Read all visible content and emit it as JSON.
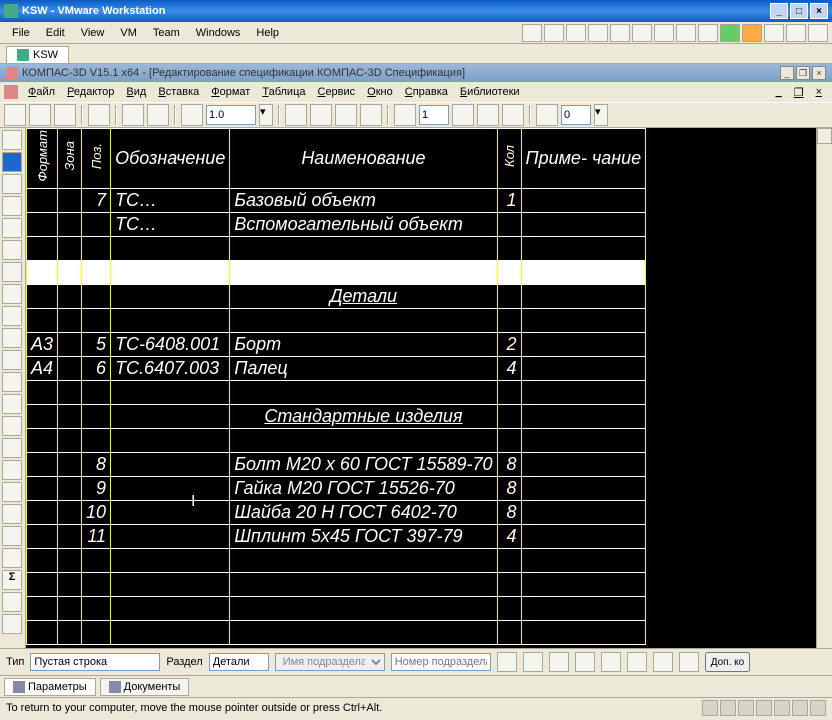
{
  "vmware": {
    "title": "KSW - VMware Workstation",
    "menu": [
      "File",
      "Edit",
      "View",
      "VM",
      "Team",
      "Windows",
      "Help"
    ],
    "tab": "KSW",
    "status": "To return to your computer, move the mouse pointer outside or press Ctrl+Alt."
  },
  "kompas": {
    "title": "КОМПАС-3D V15.1 x64 - [Редактирование спецификации КОМПАС-3D Спецификация]",
    "menu": [
      "Файл",
      "Редактор",
      "Вид",
      "Вставка",
      "Формат",
      "Таблица",
      "Сервис",
      "Окно",
      "Справка",
      "Библиотеки"
    ],
    "zoom": "1.0",
    "page": "1",
    "offset": "0"
  },
  "spec": {
    "headers": {
      "format": "Формат",
      "zona": "Зона",
      "poz": "Поз.",
      "oboz": "Обозначение",
      "naim": "Наименование",
      "kol": "Кол",
      "prim": "Приме-\nчание"
    },
    "rows": [
      {
        "fmt": "",
        "zona": "",
        "poz": "7",
        "oboz": "ТС…",
        "naim": "Базовый объект",
        "kol": "1",
        "prim": ""
      },
      {
        "fmt": "",
        "zona": "",
        "poz": "",
        "oboz": "ТС…",
        "naim": "Вспомогательный объект",
        "kol": "",
        "prim": ""
      },
      {
        "type": "empty"
      },
      {
        "type": "selected"
      },
      {
        "type": "section",
        "naim": "Детали"
      },
      {
        "type": "empty"
      },
      {
        "fmt": "А3",
        "zona": "",
        "poz": "5",
        "oboz": "ТС-6408.001",
        "naim": "Борт",
        "kol": "2",
        "prim": ""
      },
      {
        "fmt": "А4",
        "zona": "",
        "poz": "6",
        "oboz": "ТС.6407.003",
        "naim": "Палец",
        "kol": "4",
        "prim": ""
      },
      {
        "type": "empty"
      },
      {
        "type": "section",
        "naim": "Стандартные изделия"
      },
      {
        "type": "empty"
      },
      {
        "fmt": "",
        "zona": "",
        "poz": "8",
        "oboz": "",
        "naim": "Болт М20 х 60 ГОСТ 15589-70",
        "kol": "8",
        "prim": ""
      },
      {
        "fmt": "",
        "zona": "",
        "poz": "9",
        "oboz": "",
        "naim": "Гайка М20 ГОСТ 15526-70",
        "kol": "8",
        "prim": ""
      },
      {
        "fmt": "",
        "zona": "",
        "poz": "10",
        "oboz": "",
        "naim": "Шайба 20 Н ГОСТ 6402-70",
        "kol": "8",
        "prim": ""
      },
      {
        "fmt": "",
        "zona": "",
        "poz": "11",
        "oboz": "",
        "naim": "Шплинт 5х45 ГОСТ 397-79",
        "kol": "4",
        "prim": ""
      },
      {
        "type": "empty"
      },
      {
        "type": "empty"
      },
      {
        "type": "empty"
      },
      {
        "type": "empty"
      }
    ]
  },
  "bottom": {
    "tip_label": "Тип",
    "tip_value": "Пустая строка",
    "razdel_label": "Раздел",
    "razdel_value": "Детали",
    "imya_placeholder": "Имя подраздела",
    "nomer_placeholder": "Номер подраздела",
    "dop_button": "Доп. ко"
  },
  "tabs": {
    "params": "Параметры",
    "docs": "Документы"
  }
}
